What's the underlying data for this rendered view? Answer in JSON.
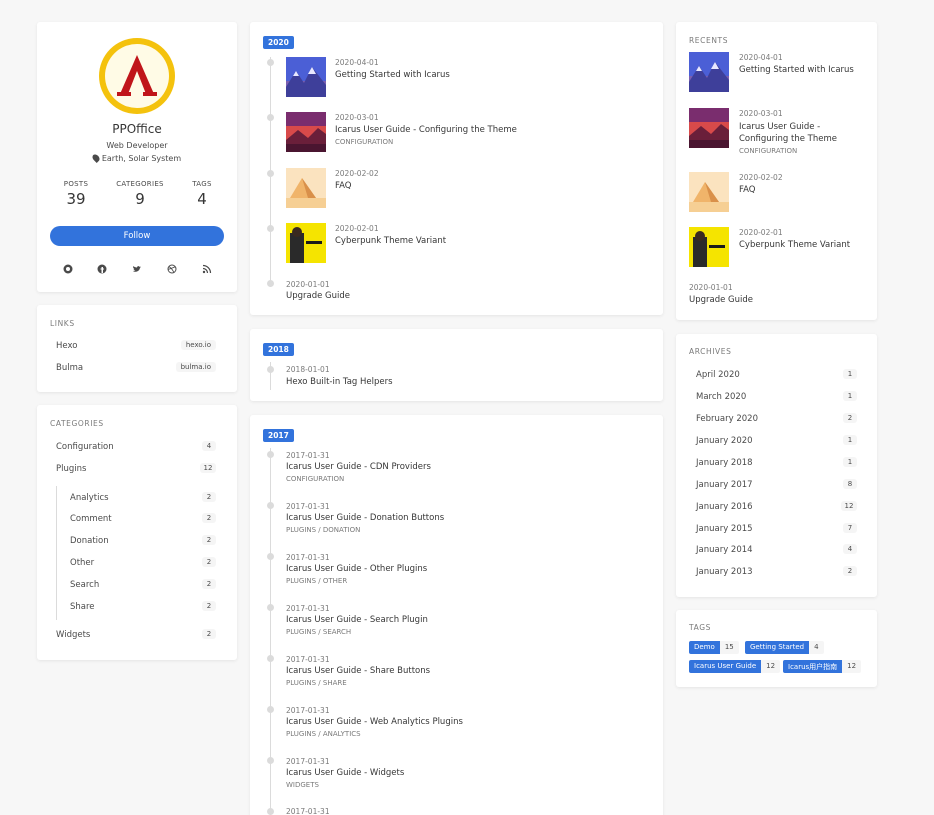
{
  "profile": {
    "name": "PPOffice",
    "role": "Web Developer",
    "location": "Earth, Solar System",
    "stats": [
      {
        "label": "POSTS",
        "value": "39"
      },
      {
        "label": "CATEGORIES",
        "value": "9"
      },
      {
        "label": "TAGS",
        "value": "4"
      }
    ],
    "follow_label": "Follow",
    "social_icons": [
      "github-icon",
      "facebook-icon",
      "twitter-icon",
      "dribbble-icon",
      "rss-icon"
    ]
  },
  "links": {
    "heading": "LINKS",
    "items": [
      {
        "name": "Hexo",
        "badge": "hexo.io"
      },
      {
        "name": "Bulma",
        "badge": "bulma.io"
      }
    ]
  },
  "categories": {
    "heading": "CATEGORIES",
    "items": [
      {
        "name": "Configuration",
        "count": "4"
      },
      {
        "name": "Plugins",
        "count": "12"
      }
    ],
    "sub_items": [
      {
        "name": "Analytics",
        "count": "2"
      },
      {
        "name": "Comment",
        "count": "2"
      },
      {
        "name": "Donation",
        "count": "2"
      },
      {
        "name": "Other",
        "count": "2"
      },
      {
        "name": "Search",
        "count": "2"
      },
      {
        "name": "Share",
        "count": "2"
      }
    ],
    "last_item": {
      "name": "Widgets",
      "count": "2"
    }
  },
  "timeline": {
    "groups": [
      {
        "year": "2020",
        "posts": [
          {
            "date": "2020-04-01",
            "title": "Getting Started with Icarus",
            "category": "",
            "thumb": "mountains"
          },
          {
            "date": "2020-03-01",
            "title": "Icarus User Guide - Configuring the Theme",
            "category": "CONFIGURATION",
            "thumb": "sunset"
          },
          {
            "date": "2020-02-02",
            "title": "FAQ",
            "category": "",
            "thumb": "desert"
          },
          {
            "date": "2020-02-01",
            "title": "Cyberpunk Theme Variant",
            "category": "",
            "thumb": "cyberpunk"
          },
          {
            "date": "2020-01-01",
            "title": "Upgrade Guide",
            "category": "",
            "thumb": ""
          }
        ]
      },
      {
        "year": "2018",
        "posts": [
          {
            "date": "2018-01-01",
            "title": "Hexo Built-in Tag Helpers",
            "category": ""
          }
        ]
      },
      {
        "year": "2017",
        "posts": [
          {
            "date": "2017-01-31",
            "title": "Icarus User Guide - CDN Providers",
            "category": "CONFIGURATION"
          },
          {
            "date": "2017-01-31",
            "title": "Icarus User Guide - Donation Buttons",
            "category": "PLUGINS / DONATION"
          },
          {
            "date": "2017-01-31",
            "title": "Icarus User Guide - Other Plugins",
            "category": "PLUGINS / OTHER"
          },
          {
            "date": "2017-01-31",
            "title": "Icarus User Guide - Search Plugin",
            "category": "PLUGINS / SEARCH"
          },
          {
            "date": "2017-01-31",
            "title": "Icarus User Guide - Share Buttons",
            "category": "PLUGINS / SHARE"
          },
          {
            "date": "2017-01-31",
            "title": "Icarus User Guide - Web Analytics Plugins",
            "category": "PLUGINS / ANALYTICS"
          },
          {
            "date": "2017-01-31",
            "title": "Icarus User Guide - Widgets",
            "category": "WIDGETS"
          },
          {
            "date": "2017-01-31",
            "title": "",
            "category": ""
          }
        ]
      }
    ]
  },
  "recents": {
    "heading": "RECENTS",
    "items": [
      {
        "date": "2020-04-01",
        "title": "Getting Started with Icarus",
        "category": ""
      },
      {
        "date": "2020-03-01",
        "title": "Icarus User Guide - Configuring the Theme",
        "category": "CONFIGURATION"
      },
      {
        "date": "2020-02-02",
        "title": "FAQ",
        "category": ""
      },
      {
        "date": "2020-02-01",
        "title": "Cyberpunk Theme Variant",
        "category": ""
      },
      {
        "date": "2020-01-01",
        "title": "Upgrade Guide",
        "category": ""
      }
    ]
  },
  "archives": {
    "heading": "ARCHIVES",
    "items": [
      {
        "name": "April 2020",
        "count": "1"
      },
      {
        "name": "March 2020",
        "count": "1"
      },
      {
        "name": "February 2020",
        "count": "2"
      },
      {
        "name": "January 2020",
        "count": "1"
      },
      {
        "name": "January 2018",
        "count": "1"
      },
      {
        "name": "January 2017",
        "count": "8"
      },
      {
        "name": "January 2016",
        "count": "12"
      },
      {
        "name": "January 2015",
        "count": "7"
      },
      {
        "name": "January 2014",
        "count": "4"
      },
      {
        "name": "January 2013",
        "count": "2"
      }
    ]
  },
  "tags": {
    "heading": "TAGS",
    "items": [
      {
        "name": "Demo",
        "count": "15"
      },
      {
        "name": "Getting Started",
        "count": "4"
      },
      {
        "name": "Icarus User Guide",
        "count": "12"
      },
      {
        "name": "Icarus用户指南",
        "count": "12"
      }
    ]
  },
  "colors": {
    "accent": "#3273dc",
    "logo_ring": "#f4c20d",
    "logo_red": "#c0151a"
  }
}
